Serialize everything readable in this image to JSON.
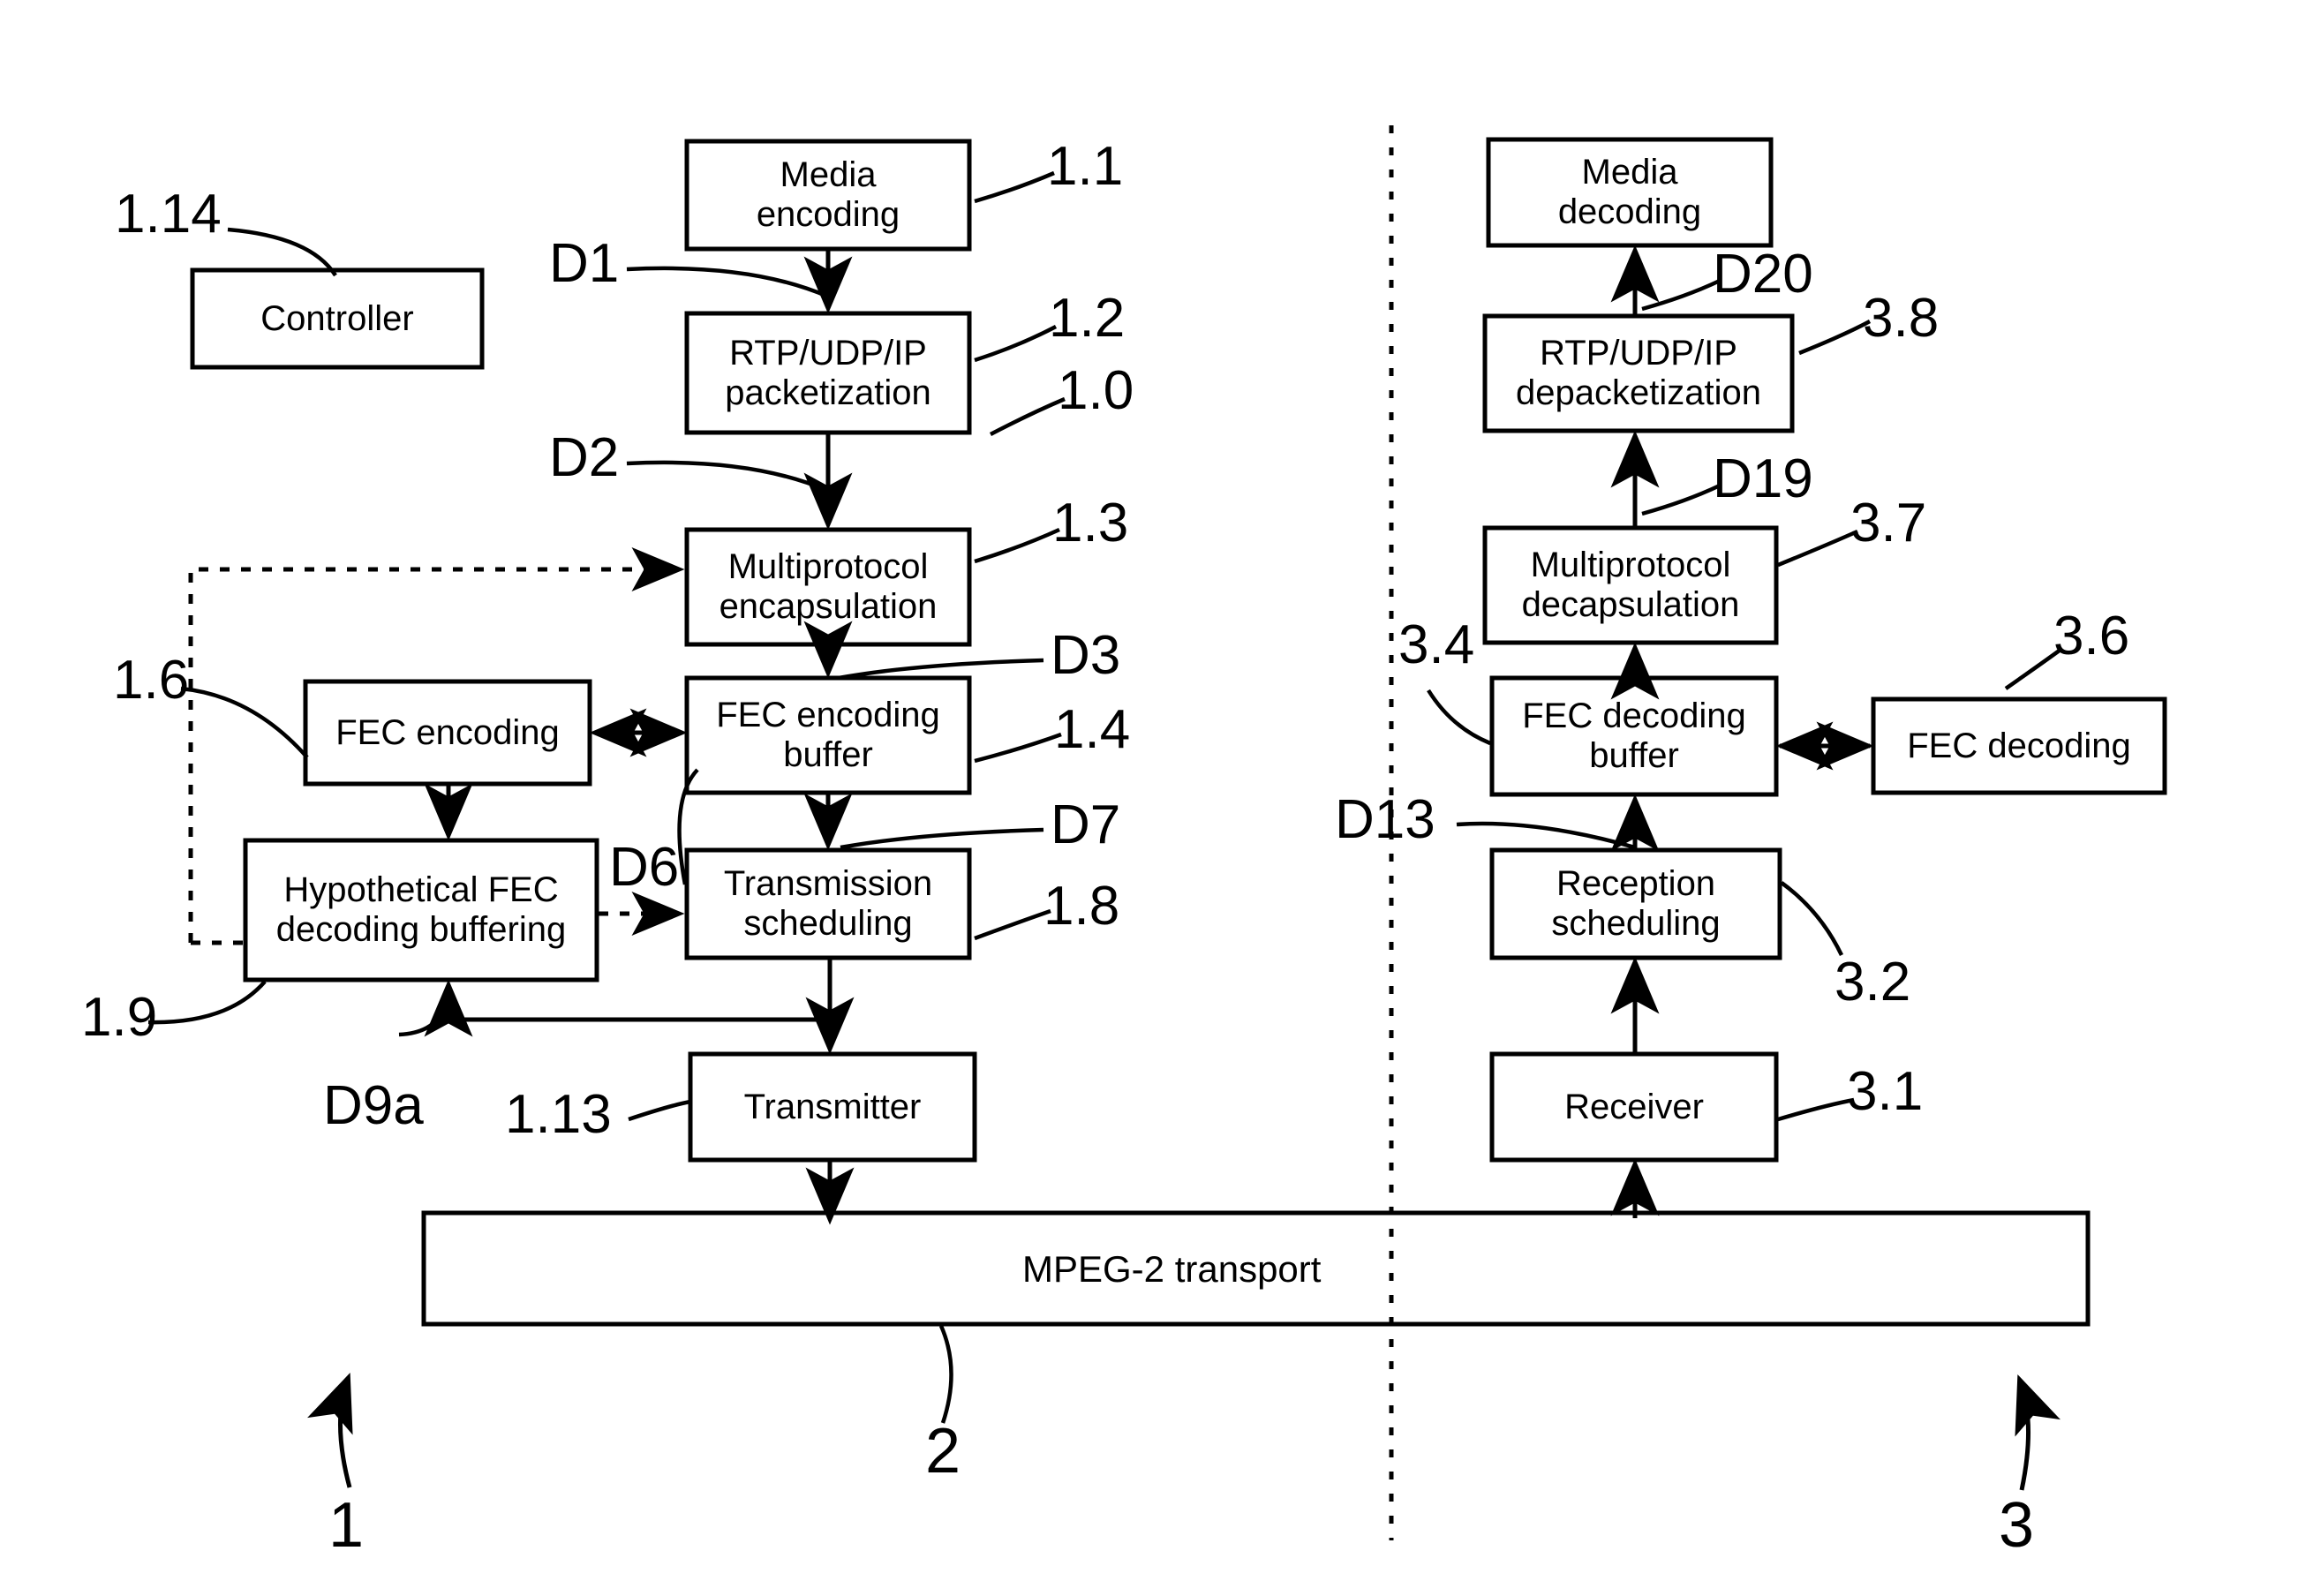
{
  "figure": {
    "title": "Media transport chain block diagram",
    "stroke_color": "#000000",
    "background_color": "#ffffff"
  },
  "transmitter_side": {
    "group_ref": "1",
    "subsystem_ref": "1.0",
    "blocks": [
      {
        "id": "controller",
        "label": "Controller",
        "ref": "1.14"
      },
      {
        "id": "media_encoding",
        "label": "Media\nencoding",
        "ref": "1.1"
      },
      {
        "id": "rtp_pack",
        "label": "RTP/UDP/IP\npacketization",
        "ref": "1.2"
      },
      {
        "id": "mp_encap",
        "label": "Multiprotocol\nencapsulation",
        "ref": "1.3"
      },
      {
        "id": "fec_enc_buffer",
        "label": "FEC encoding\nbuffer",
        "ref": "1.4"
      },
      {
        "id": "fec_encoding",
        "label": "FEC encoding",
        "ref": "1.6"
      },
      {
        "id": "hyp_fec_buf",
        "label": "Hypothetical FEC\ndecoding buffering",
        "ref": "1.9"
      },
      {
        "id": "tx_scheduling",
        "label": "Transmission\nscheduling",
        "ref": "1.8"
      },
      {
        "id": "transmitter",
        "label": "Transmitter",
        "ref": "1.13"
      }
    ],
    "signals": [
      {
        "id": "d1",
        "label": "D1"
      },
      {
        "id": "d2",
        "label": "D2"
      },
      {
        "id": "d3",
        "label": "D3"
      },
      {
        "id": "d7",
        "label": "D7"
      },
      {
        "id": "d6",
        "label": "D6"
      },
      {
        "id": "d9a",
        "label": "D9a"
      }
    ]
  },
  "channel": {
    "ref": "2",
    "label": "MPEG-2 transport"
  },
  "receiver_side": {
    "group_ref": "3",
    "blocks": [
      {
        "id": "media_decoding",
        "label": "Media\ndecoding",
        "ref": ""
      },
      {
        "id": "rtp_depack",
        "label": "RTP/UDP/IP\ndepacketization",
        "ref": "3.8"
      },
      {
        "id": "mp_decap",
        "label": "Multiprotocol\ndecapsulation",
        "ref": "3.7"
      },
      {
        "id": "fec_dec_buffer",
        "label": "FEC decoding\nbuffer",
        "ref": "3.4"
      },
      {
        "id": "fec_decoding",
        "label": "FEC decoding",
        "ref": "3.6"
      },
      {
        "id": "rx_scheduling",
        "label": "Reception\nscheduling",
        "ref": "3.2"
      },
      {
        "id": "receiver",
        "label": "Receiver",
        "ref": "3.1"
      }
    ],
    "signals": [
      {
        "id": "d20",
        "label": "D20"
      },
      {
        "id": "d19",
        "label": "D19"
      },
      {
        "id": "d13",
        "label": "D13"
      }
    ]
  }
}
